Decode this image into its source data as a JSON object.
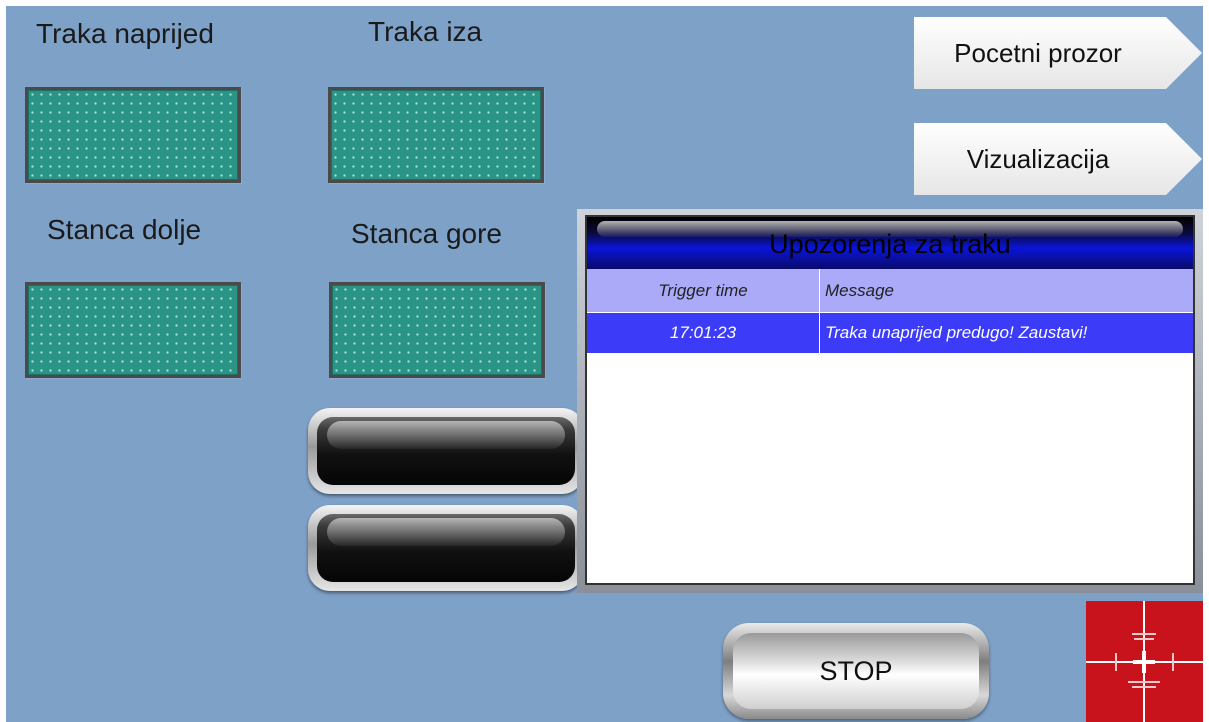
{
  "labels": {
    "traka_naprijed": "Traka naprijed",
    "traka_iza": "Traka iza",
    "stanca_dolje": "Stanca dolje",
    "stanca_gore": "Stanca gore"
  },
  "nav": {
    "pocetni": "Pocetni prozor",
    "vizualizacija": "Vizualizacija"
  },
  "alarm": {
    "title": "Upozorenja za traku",
    "columns": [
      "Trigger time",
      "Message"
    ],
    "rows": [
      {
        "time": "17:01:23",
        "message": "Traka unaprijed predugo! Zaustavi!"
      }
    ]
  },
  "stop_label": "STOP",
  "colors": {
    "background": "#7ea1c7",
    "indicator": "#2a9486",
    "alarm_header": "#aaaaf8",
    "alarm_row": "#3b3bf8",
    "logo": "#c8121c"
  }
}
